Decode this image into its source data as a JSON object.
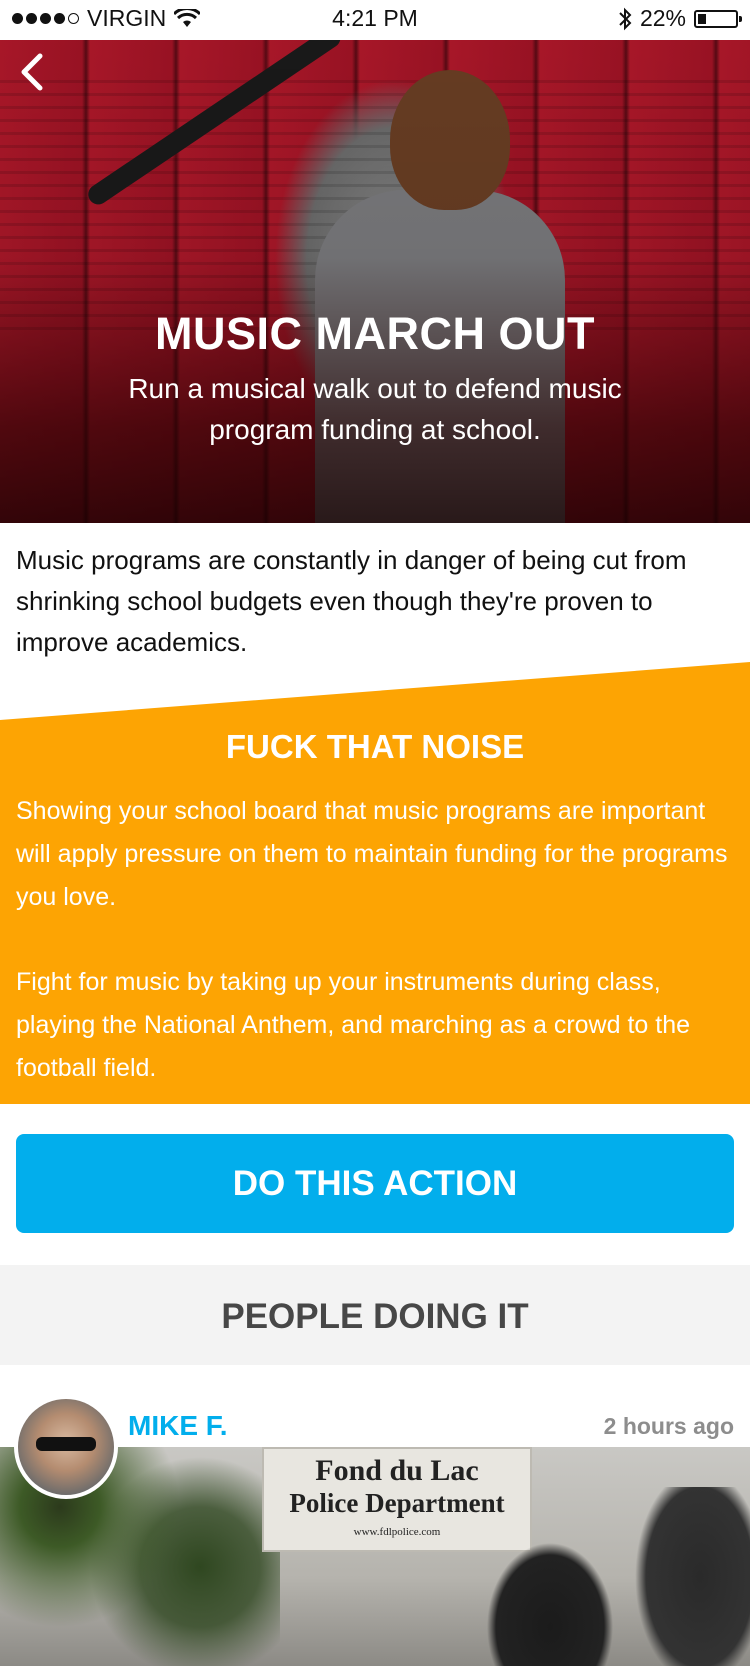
{
  "status_bar": {
    "carrier": "VIRGIN",
    "time": "4:21 PM",
    "battery": "22%",
    "battery_level": 0.22
  },
  "hero": {
    "title": "MUSIC MARCH OUT",
    "subtitle": "Run a musical walk out to defend music program funding at school."
  },
  "intro": {
    "text": "Music programs are constantly in danger of being cut from shrinking school budgets even though they're proven to improve academics."
  },
  "why_section": {
    "title": "FUCK THAT NOISE",
    "paragraph_1": "Showing your school board that music programs are important will apply pressure on them to maintain funding for the programs you love.",
    "paragraph_2": "Fight for music by taking up your instruments during class, playing the National Anthem, and marching as a crowd to the football field."
  },
  "cta": {
    "label": "DO THIS ACTION"
  },
  "people": {
    "title": "PEOPLE DOING IT",
    "posts": [
      {
        "user": "MIKE F.",
        "time": "2 hours ago",
        "photo_sign": {
          "line1": "Fond du Lac",
          "line2": "Police Department",
          "line3": "www.fdlpolice.com"
        }
      }
    ]
  },
  "colors": {
    "orange": "#fda403",
    "blue": "#02aeec",
    "header_gray": "#474747"
  }
}
